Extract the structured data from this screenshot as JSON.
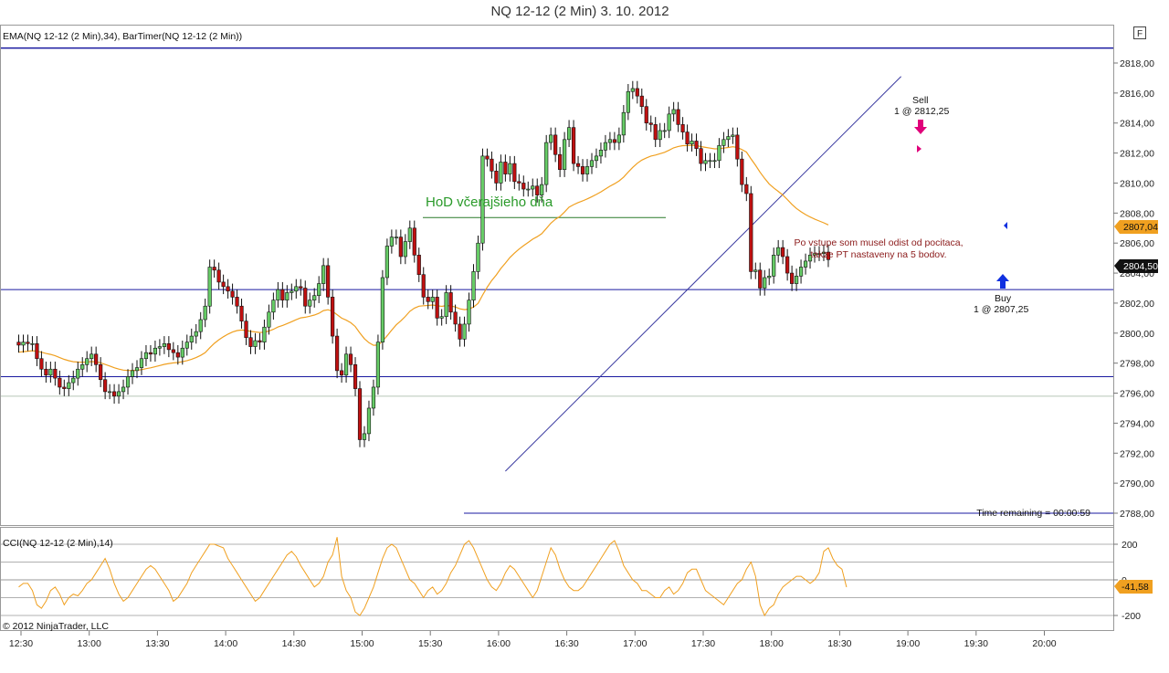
{
  "window": {
    "title": "NQ 12-12 (2 Min)  3. 10. 2012",
    "f_button": "F"
  },
  "chart_data": [
    {
      "type": "candlestick",
      "panel": "price",
      "indicator_label": "EMA(NQ 12-12 (2 Min),34), BarTimer(NQ 12-12 (2 Min))",
      "ylim": [
        2787,
        2819.5
      ],
      "y_ticks": [
        "2818,00",
        "2816,00",
        "2814,00",
        "2812,00",
        "2810,00",
        "2808,00",
        "2806,00",
        "2804,00",
        "2802,00",
        "2800,00",
        "2798,00",
        "2796,00",
        "2794,00",
        "2792,00",
        "2790,00",
        "2788,00"
      ],
      "x_ticks": [
        "12:30",
        "13:00",
        "13:30",
        "14:00",
        "14:30",
        "15:00",
        "15:30",
        "16:00",
        "16:30",
        "17:00",
        "17:30",
        "18:00",
        "18:30",
        "19:00",
        "19:30",
        "20:00"
      ],
      "start_time": "12:29",
      "bar_minutes": 2,
      "closes": [
        2799.2,
        2799.4,
        2799.3,
        2799.3,
        2798.3,
        2797.6,
        2797.2,
        2797.6,
        2797.0,
        2796.4,
        2796.3,
        2796.7,
        2797.0,
        2797.6,
        2797.9,
        2798.3,
        2798.6,
        2797.9,
        2796.9,
        2796.1,
        2796.1,
        2795.8,
        2796.1,
        2796.4,
        2797.1,
        2797.5,
        2797.7,
        2798.3,
        2798.7,
        2798.6,
        2799.0,
        2799.1,
        2799.3,
        2798.9,
        2798.7,
        2798.4,
        2799.0,
        2799.4,
        2799.8,
        2800.1,
        2800.9,
        2801.8,
        2804.4,
        2804.2,
        2803.4,
        2803.1,
        2802.8,
        2802.4,
        2801.8,
        2800.8,
        2799.7,
        2799.1,
        2799.5,
        2799.4,
        2800.4,
        2801.4,
        2802.2,
        2802.9,
        2802.2,
        2802.7,
        2802.8,
        2803.1,
        2803.0,
        2801.8,
        2802.2,
        2802.5,
        2803.3,
        2804.5,
        2802.4,
        2799.8,
        2797.5,
        2797.2,
        2798.6,
        2797.9,
        2796.3,
        2792.9,
        2793.3,
        2795.0,
        2796.4,
        2799.4,
        2803.7,
        2805.8,
        2806.4,
        2806.4,
        2805.1,
        2806.1,
        2807.0,
        2805.2,
        2803.9,
        2802.4,
        2802.1,
        2802.4,
        2801.0,
        2801.1,
        2802.7,
        2801.4,
        2800.6,
        2799.6,
        2800.6,
        2802.2,
        2804.1,
        2806.0,
        2811.8,
        2811.6,
        2810.8,
        2810.0,
        2811.4,
        2810.6,
        2811.3,
        2810.1,
        2810.0,
        2809.6,
        2809.6,
        2809.8,
        2809.2,
        2809.9,
        2812.7,
        2813.2,
        2811.9,
        2810.9,
        2812.9,
        2813.7,
        2811.3,
        2811.1,
        2810.6,
        2811.1,
        2811.5,
        2811.8,
        2812.2,
        2812.7,
        2812.9,
        2812.7,
        2813.2,
        2814.7,
        2816.1,
        2816.3,
        2815.8,
        2815.1,
        2814.0,
        2813.9,
        2812.9,
        2813.5,
        2813.5,
        2814.6,
        2814.9,
        2813.9,
        2813.4,
        2812.6,
        2812.8,
        2812.3,
        2811.3,
        2811.5,
        2811.5,
        2811.5,
        2812.5,
        2812.9,
        2813.1,
        2813.2,
        2811.6,
        2809.9,
        2809.3,
        2804.1,
        2804.2,
        2803.0,
        2803.7,
        2803.8,
        2805.2,
        2805.7,
        2805.1,
        2804.0,
        2803.3,
        2803.8,
        2804.4,
        2804.8,
        2805.2,
        2805.3,
        2805.3,
        2805.4,
        2804.9
      ],
      "ema_label": "EMA 34",
      "ema_color": "#f0a020",
      "price_tag_ema": "2807,04",
      "price_tag_last": "2804,50",
      "horizontal_lines": [
        2819.0,
        2802.9,
        2797.1,
        2795.8,
        2788.0
      ],
      "trendline": {
        "from_time": "16:03",
        "from_price": 2790.8,
        "to_time": "18:57",
        "to_price": 2817.1
      },
      "annotations": {
        "hod_label": "HoD včerajšieho dňa",
        "hod_price": 2807.7,
        "note_line1": "Po vstupe som musel odist od pocitaca,",
        "note_line2": "takze PT nastaveny na 5 bodov.",
        "sell_line1": "Sell",
        "sell_line2": "1 @ 2812,25",
        "buy_line1": "Buy",
        "buy_line2": "1 @ 2807,25",
        "timer": "Time remaining = 00:00:59"
      }
    },
    {
      "type": "line",
      "panel": "oscillator",
      "indicator_label": "CCI(NQ 12-12 (2 Min),14)",
      "ylim": [
        -260,
        260
      ],
      "y_ticks": [
        "200",
        "0",
        "-200"
      ],
      "levels": [
        200,
        100,
        0,
        -100,
        -200
      ],
      "last_value_tag": "-41,58",
      "line_color": "#f0a020",
      "values": [
        -40,
        -20,
        -20,
        -60,
        -140,
        -160,
        -120,
        -60,
        -40,
        -80,
        -140,
        -100,
        -80,
        -90,
        -60,
        -20,
        0,
        40,
        80,
        120,
        60,
        -20,
        -80,
        -120,
        -100,
        -60,
        -20,
        20,
        60,
        80,
        60,
        20,
        -20,
        -60,
        -120,
        -100,
        -60,
        -20,
        40,
        80,
        120,
        160,
        200,
        200,
        190,
        180,
        120,
        80,
        40,
        0,
        -40,
        -80,
        -120,
        -100,
        -60,
        -20,
        20,
        60,
        100,
        140,
        160,
        130,
        80,
        40,
        0,
        -40,
        -20,
        20,
        100,
        140,
        240,
        20,
        -60,
        -100,
        -180,
        -200,
        -160,
        -100,
        -40,
        40,
        120,
        180,
        200,
        180,
        120,
        60,
        0,
        -20,
        -60,
        -100,
        -60,
        -40,
        -80,
        -60,
        -20,
        40,
        80,
        140,
        200,
        220,
        180,
        120,
        60,
        0,
        -40,
        -60,
        -20,
        40,
        80,
        60,
        20,
        -20,
        -60,
        -100,
        -60,
        20,
        100,
        180,
        140,
        60,
        0,
        -40,
        -60,
        -60,
        -40,
        0,
        40,
        80,
        120,
        160,
        200,
        220,
        160,
        80,
        40,
        0,
        -20,
        -60,
        -60,
        -80,
        -100,
        -100,
        -60,
        -40,
        -80,
        -60,
        -20,
        40,
        60,
        60,
        0,
        -60,
        -80,
        -100,
        -120,
        -140,
        -100,
        -60,
        -20,
        0,
        60,
        100,
        20,
        -140,
        -200,
        -160,
        -140,
        -80,
        -40,
        -20,
        0,
        20,
        20,
        0,
        -20,
        0,
        40,
        160,
        180,
        120,
        80,
        60,
        -41
      ]
    }
  ],
  "footer": {
    "copyright": "© 2012 NinjaTrader, LLC"
  }
}
